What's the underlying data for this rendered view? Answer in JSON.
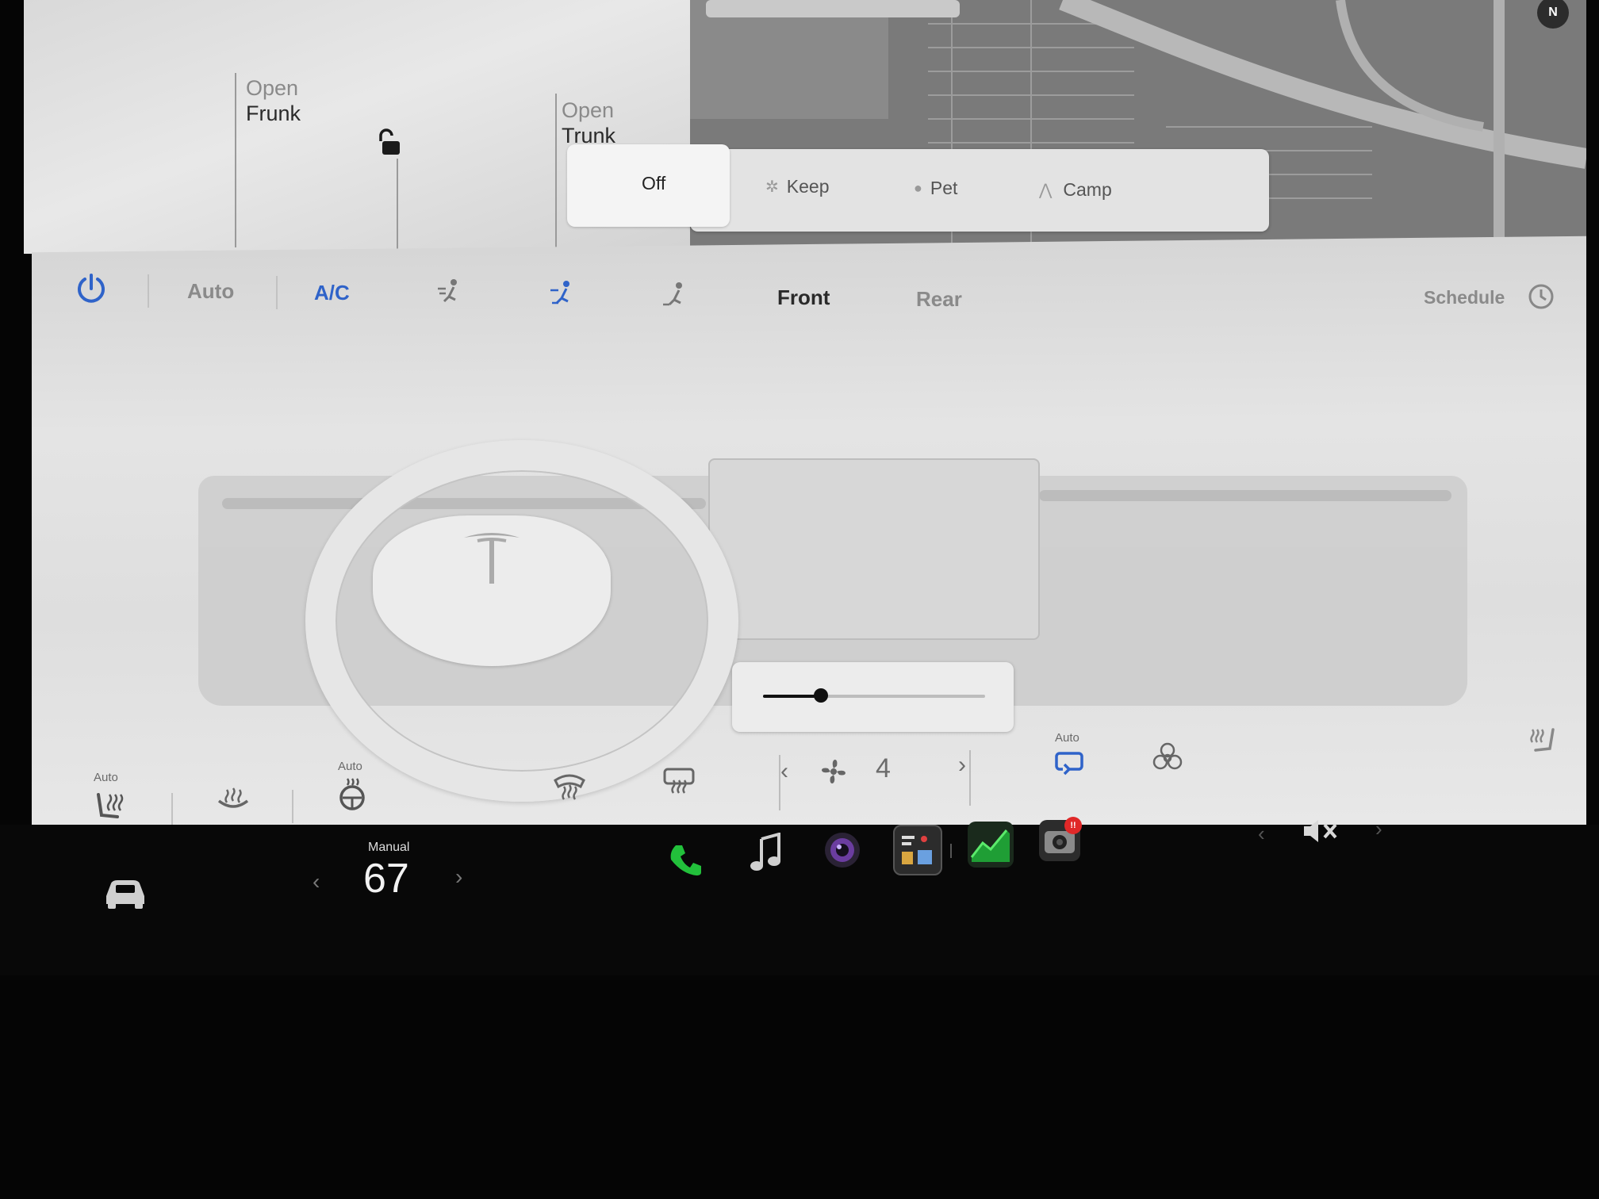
{
  "trunk_panel": {
    "frunk_open": "Open",
    "frunk_name": "Frunk",
    "trunk_open": "Open",
    "trunk_name": "Trunk"
  },
  "map": {
    "compass": "N"
  },
  "climate_keeper": {
    "off": "Off",
    "keep": "Keep",
    "pet": "Pet",
    "camp": "Camp"
  },
  "climate_toolbar": {
    "auto": "Auto",
    "ac": "A/C",
    "front": "Front",
    "rear": "Rear",
    "schedule": "Schedule"
  },
  "fan": {
    "speed": "4",
    "level_fraction": 0.26
  },
  "bottom_controls": {
    "driver_seat_auto": "Auto",
    "wheel_heat_auto": "Auto",
    "recirc_auto": "Auto"
  },
  "taskbar": {
    "temp_mode": "Manual",
    "temperature": "67",
    "camera_badge": "!!"
  },
  "colors": {
    "accent_blue": "#2f63c9",
    "phone_green": "#22c03b",
    "stocks_green": "#1f9e35",
    "badge_red": "#e02828"
  }
}
